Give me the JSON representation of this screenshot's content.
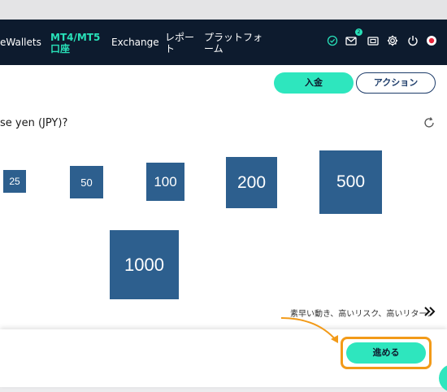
{
  "nav": {
    "items": [
      {
        "label": "eWallets"
      },
      {
        "label": "MT4/MT5\n口座",
        "active": true
      },
      {
        "label": "Exchange"
      },
      {
        "label": "レポー\nト"
      },
      {
        "label": "プラットフォ\nーム"
      }
    ],
    "icons": [
      "check-circle-icon",
      "mail-icon",
      "ticket-icon",
      "gear-icon",
      "power-icon",
      "record-icon"
    ],
    "notification_count": "2"
  },
  "actions": {
    "deposit_label": "入金",
    "action_label": "アクション"
  },
  "question": "se yen (JPY)?",
  "tiles": [
    "25",
    "50",
    "100",
    "200",
    "500",
    "1000"
  ],
  "risk_label": "素早い動き、高いリスク、高いリターン",
  "proceed_label": "進める",
  "colors": {
    "navbar": "#0d1b2e",
    "accent": "#2ee6be",
    "tile": "#2d5f8e",
    "highlight": "#f29a18"
  }
}
